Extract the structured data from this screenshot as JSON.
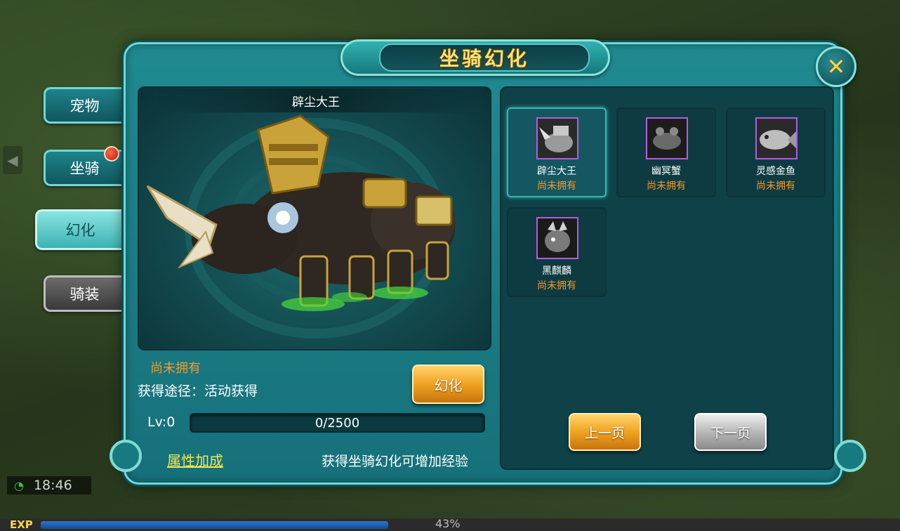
{
  "window": {
    "title": "坐骑幻化"
  },
  "tabs": [
    {
      "label": "宠物"
    },
    {
      "label": "坐骑"
    },
    {
      "label": "幻化"
    },
    {
      "label": "骑装"
    }
  ],
  "preview": {
    "name": "辟尘大王",
    "status": "尚未拥有",
    "source": "获得途径：活动获得",
    "transform_button": "幻化",
    "level_label": "Lv:0",
    "exp_text": "0/2500",
    "attr_link": "属性加成",
    "hint": "获得坐骑幻化可增加经验"
  },
  "mounts": [
    {
      "name": "辟尘大王",
      "status": "尚未拥有",
      "selected": true
    },
    {
      "name": "幽冥蟹",
      "status": "尚未拥有",
      "selected": false
    },
    {
      "name": "灵感金鱼",
      "status": "尚未拥有",
      "selected": false
    },
    {
      "name": "黑麒麟",
      "status": "尚未拥有",
      "selected": false
    }
  ],
  "pager": {
    "prev": "上一页",
    "next": "下一页"
  },
  "hud": {
    "time": "18:46",
    "exp_label": "EXP",
    "exp_percent": "43%",
    "exp_fraction": 0.43
  },
  "colors": {
    "accent": "#1f8a90",
    "status_orange": "#f39b2b",
    "link_yellow": "#f6e64a",
    "gold_button": "#f0a322"
  }
}
